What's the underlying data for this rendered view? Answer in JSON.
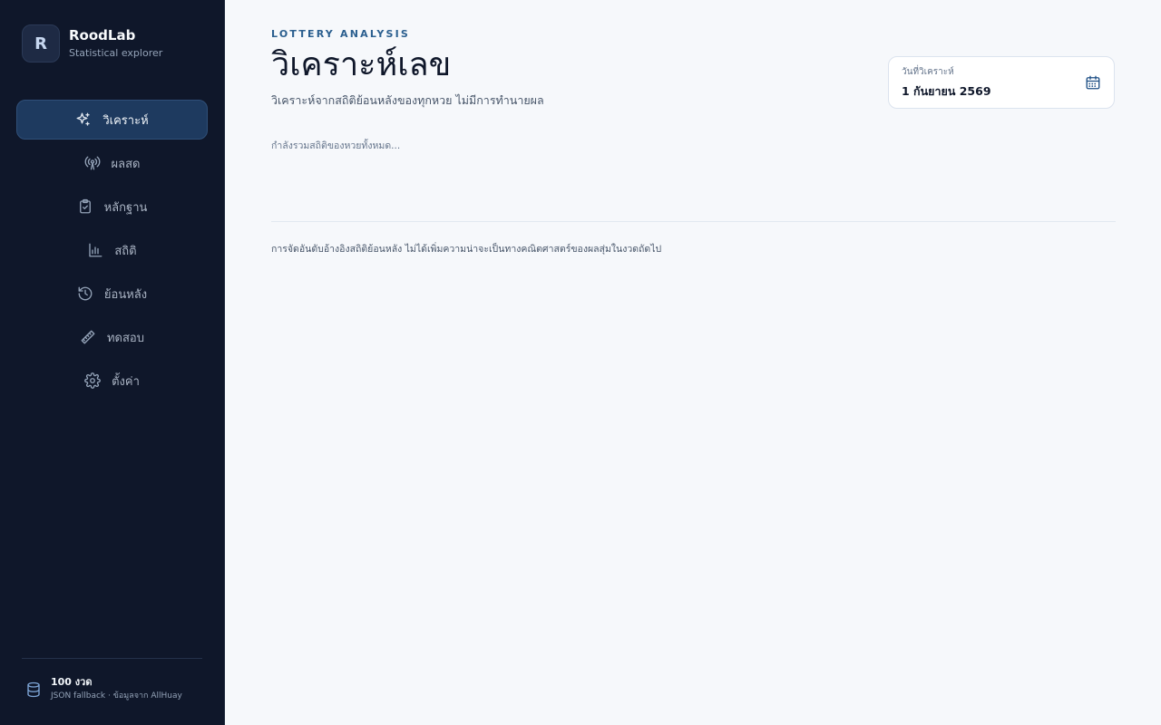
{
  "brand": {
    "logo_letter": "R",
    "name": "RoodLab",
    "tagline": "Statistical explorer"
  },
  "nav": {
    "items": [
      {
        "label": "วิเคราะห์",
        "icon": "sparkles-icon",
        "active": true
      },
      {
        "label": "ผลสด",
        "icon": "broadcast-icon",
        "active": false
      },
      {
        "label": "หลักฐาน",
        "icon": "clipboard-check-icon",
        "active": false
      },
      {
        "label": "สถิติ",
        "icon": "bar-chart-icon",
        "active": false
      },
      {
        "label": "ย้อนหลัง",
        "icon": "history-icon",
        "active": false
      },
      {
        "label": "ทดสอบ",
        "icon": "ruler-icon",
        "active": false
      },
      {
        "label": "ตั้งค่า",
        "icon": "gear-icon",
        "active": false
      }
    ]
  },
  "footer": {
    "icon": "database-icon",
    "title": "100 งวด",
    "subtitle": "JSON fallback · ข้อมูลจาก AllHuay"
  },
  "header": {
    "eyebrow": "LOTTERY ANALYSIS",
    "title": "วิเคราะห์เลข",
    "subtitle": "วิเคราะห์จากสถิติย้อนหลังของทุกหวย ไม่มีการทำนายผล"
  },
  "date_picker": {
    "label": "วันที่วิเคราะห์",
    "value": "1 กันยายน 2569",
    "icon": "calendar-icon"
  },
  "status": {
    "loading_text": "กำลังรวมสถิติของหวยทั้งหมด..."
  },
  "disclaimer": "การจัดอันดับอ้างอิงสถิติย้อนหลัง ไม่ได้เพิ่มความน่าจะเป็นทางคณิตศาสตร์ของผลสุ่มในงวดถัดไป",
  "colors": {
    "sidebar_bg": "#0f172a",
    "active_item_bg": "#1e3a5f",
    "accent": "#2b5f8f",
    "page_bg": "#f6f8fb"
  }
}
